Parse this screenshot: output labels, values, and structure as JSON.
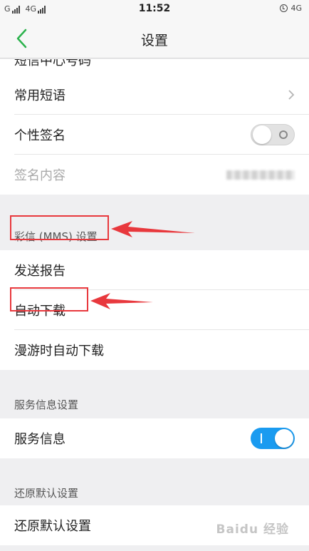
{
  "status_bar": {
    "carrier_1": "G",
    "carrier_2": "4G",
    "time": "11:52",
    "right_network": "4G"
  },
  "nav": {
    "title": "设置",
    "back_icon": "chevron-left-icon",
    "accent_color": "#2bb24c"
  },
  "rows": {
    "cut_off": "短信中心号码",
    "common_phrases": "常用短语",
    "signature": "个性签名",
    "signature_content": "签名内容"
  },
  "toggles": {
    "signature_on": false,
    "service_info_on": true,
    "on_color": "#1a9bf0"
  },
  "mms_section": {
    "header": "彩信 (MMS) 设置",
    "delivery_report": "发送报告",
    "auto_download": "自动下载",
    "roaming_auto_download": "漫游时自动下载"
  },
  "service_section": {
    "header": "服务信息设置",
    "service_info": "服务信息"
  },
  "restore_section": {
    "header": "还原默认设置",
    "restore_defaults": "还原默认设置"
  },
  "annotation_color": "#e8383d",
  "watermark": "Baidu 经验"
}
